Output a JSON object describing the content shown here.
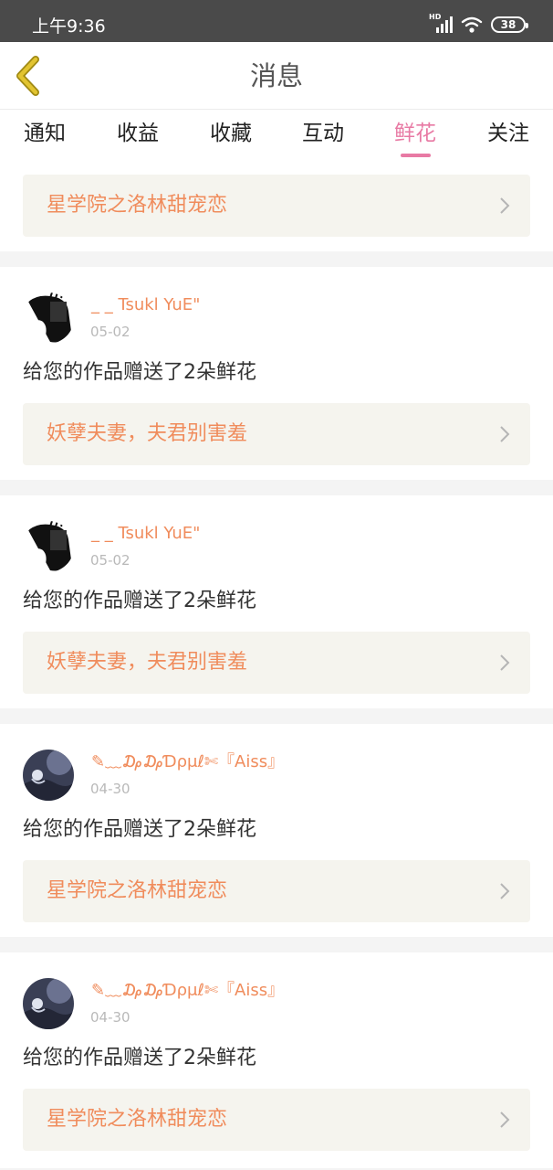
{
  "status_bar": {
    "time": "上午9:36",
    "network_label": "HD",
    "battery": "38"
  },
  "nav": {
    "title": "消息",
    "back_icon": "chevron-left-icon",
    "accent": "#e2c431"
  },
  "tabs": [
    {
      "label": "通知",
      "active": false
    },
    {
      "label": "收益",
      "active": false
    },
    {
      "label": "收藏",
      "active": false
    },
    {
      "label": "互动",
      "active": false
    },
    {
      "label": "鲜花",
      "active": true
    },
    {
      "label": "关注",
      "active": false
    }
  ],
  "colors": {
    "active_tab": "#e87aa4",
    "username": "#f08c5c",
    "link_text": "#f08c5c",
    "link_bg": "#f5f4ee"
  },
  "top_link": {
    "title": "星学院之洛林甜宠恋"
  },
  "items": [
    {
      "username": "_ _ Tsukl YuE\"",
      "date": "05-02",
      "message": "给您的作品赠送了2朵鲜花",
      "work": "妖孽夫妻，夫君别害羞",
      "avatar": "bw-avatar"
    },
    {
      "username": "_ _ Tsukl YuE\"",
      "date": "05-02",
      "message": "给您的作品赠送了2朵鲜花",
      "work": "妖孽夫妻，夫君别害羞",
      "avatar": "bw-avatar"
    },
    {
      "username": "✎﹏₯₯Ɗρμℓ✄『Aiss』",
      "date": "04-30",
      "message": "给您的作品赠送了2朵鲜花",
      "work": "星学院之洛林甜宠恋",
      "avatar": "blue-avatar"
    },
    {
      "username": "✎﹏₯₯Ɗρμℓ✄『Aiss』",
      "date": "04-30",
      "message": "给您的作品赠送了2朵鲜花",
      "work": "星学院之洛林甜宠恋",
      "avatar": "blue-avatar"
    }
  ]
}
